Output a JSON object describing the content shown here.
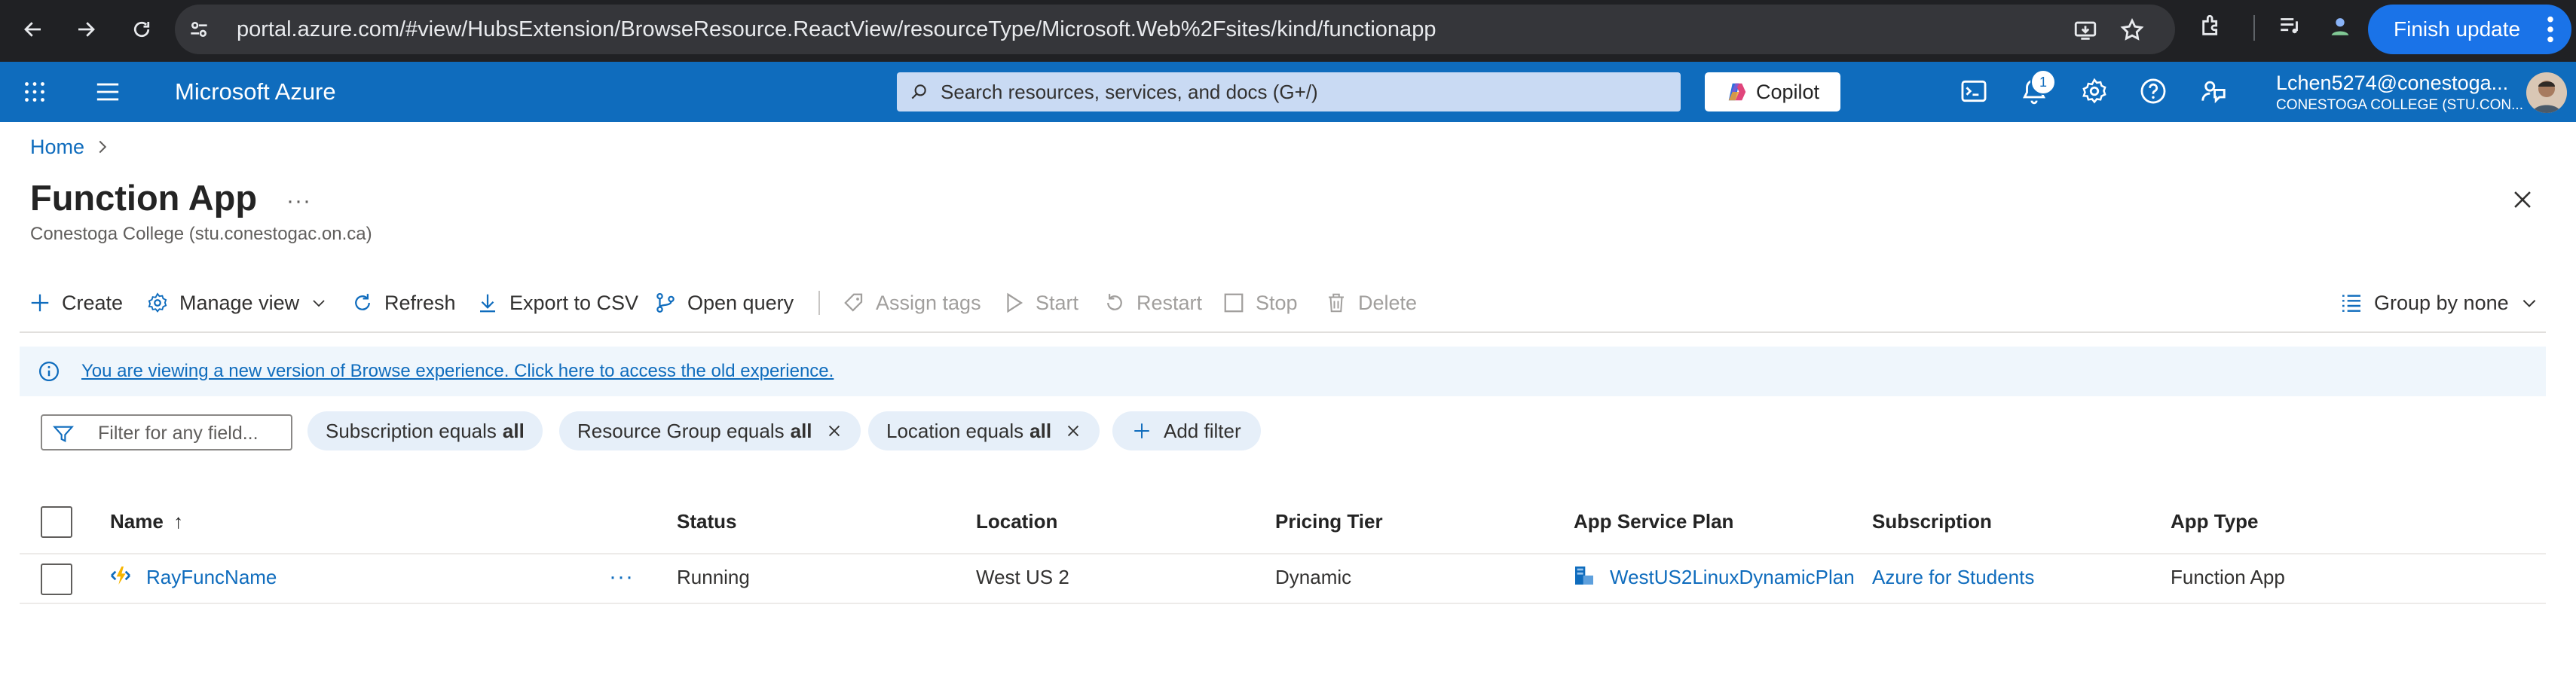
{
  "browser": {
    "url": "portal.azure.com/#view/HubsExtension/BrowseResource.ReactView/resourceType/Microsoft.Web%2Fsites/kind/functionapp",
    "finish_update_label": "Finish update"
  },
  "header": {
    "brand": "Microsoft Azure",
    "search_placeholder": "Search resources, services, and docs (G+/)",
    "copilot_label": "Copilot",
    "notification_count": "1",
    "user_email": "Lchen5274@conestoga...",
    "user_directory": "CONESTOGA COLLEGE (STU.CON..."
  },
  "breadcrumb": {
    "home": "Home"
  },
  "page": {
    "title": "Function App",
    "subtitle": "Conestoga College (stu.conestogac.on.ca)"
  },
  "toolbar": {
    "create": "Create",
    "manage_view": "Manage view",
    "refresh": "Refresh",
    "export_csv": "Export to CSV",
    "open_query": "Open query",
    "assign_tags": "Assign tags",
    "start": "Start",
    "restart": "Restart",
    "stop": "Stop",
    "delete": "Delete",
    "group_by": "Group by none"
  },
  "info_banner": {
    "text": "You are viewing a new version of Browse experience. Click here to access the old experience."
  },
  "filters": {
    "placeholder": "Filter for any field...",
    "subscription_prefix": "Subscription equals",
    "subscription_value": "all",
    "rg_prefix": "Resource Group equals",
    "rg_value": "all",
    "location_prefix": "Location equals",
    "location_value": "all",
    "add_filter": "Add filter"
  },
  "table": {
    "columns": {
      "name": "Name",
      "name_sort": "↑",
      "status": "Status",
      "location": "Location",
      "pricing": "Pricing Tier",
      "plan": "App Service Plan",
      "subscription": "Subscription",
      "apptype": "App Type"
    },
    "rows": [
      {
        "name": "RayFuncName",
        "status": "Running",
        "location": "West US 2",
        "pricing": "Dynamic",
        "plan": "WestUS2LinuxDynamicPlan",
        "subscription": "Azure for Students",
        "apptype": "Function App"
      }
    ]
  },
  "colors": {
    "azure_blue": "#0f6cbd",
    "chrome_dark": "#202124",
    "chrome_update_blue": "#1a73e8"
  }
}
